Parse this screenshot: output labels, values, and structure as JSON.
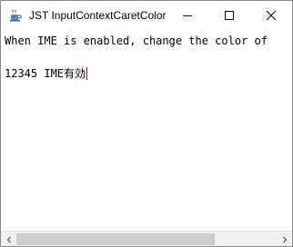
{
  "window": {
    "title": "JST InputContextCaretColor"
  },
  "editor": {
    "line1": "When IME is enabled, change the color of",
    "line2": "12345 IME有効",
    "caret_color": "#e00000"
  },
  "icons": {
    "app": "java-cup-icon",
    "minimize": "minimize-icon",
    "maximize": "maximize-icon",
    "close": "close-icon",
    "scroll_left": "chevron-left-icon",
    "scroll_right": "chevron-right-icon"
  },
  "hscroll": {
    "thumb_fraction_start": 0.0,
    "thumb_fraction_size": 0.76
  }
}
